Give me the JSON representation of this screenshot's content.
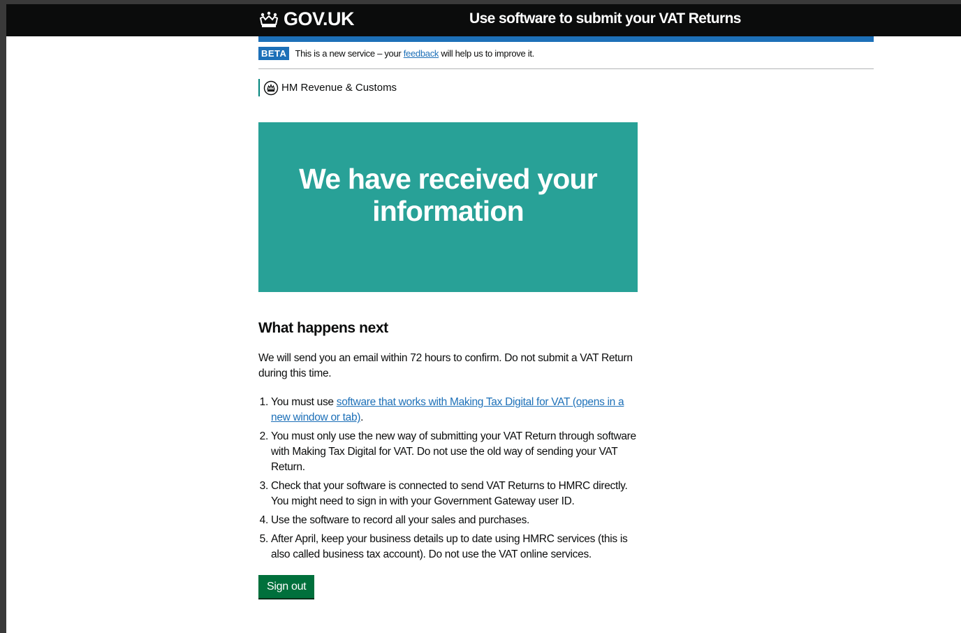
{
  "header": {
    "logo_text": "GOV.UK",
    "service_name": "Use software to submit your VAT Returns"
  },
  "phase_banner": {
    "tag": "BETA",
    "text_before": "This is a new service – your ",
    "link_text": "feedback",
    "text_after": " will help us to improve it."
  },
  "organisation": {
    "name": "HM Revenue & Customs"
  },
  "confirmation_panel": {
    "title": "We have received your information"
  },
  "main": {
    "heading": "What happens next",
    "intro": "We will send you an email within 72 hours to confirm. Do not submit a VAT Return during this time.",
    "steps": [
      {
        "before": "You must use ",
        "link": "software that works with Making Tax Digital for VAT (opens in a new window or tab)",
        "after": "."
      },
      {
        "text": "You must only use the new way of submitting your VAT Return through software with Making Tax Digital for VAT. Do not use the old way of sending your VAT Return."
      },
      {
        "text": "Check that your software is connected to send VAT Returns to HMRC directly. You might need to sign in with your Government Gateway user ID."
      },
      {
        "text": "Use the software to record all your sales and purchases."
      },
      {
        "text": "After April, keep your business details up to date using HMRC services (this is also called business tax account). Do not use the VAT online services."
      }
    ],
    "sign_out_label": "Sign out"
  },
  "colors": {
    "header_bg": "#0b0c0c",
    "brand_blue": "#1d70b8",
    "panel_turquoise": "#28a197",
    "hmrc_line": "#00847c",
    "button_green": "#00703c"
  },
  "icons": [
    "crown-icon",
    "hmrc-crest-icon"
  ]
}
